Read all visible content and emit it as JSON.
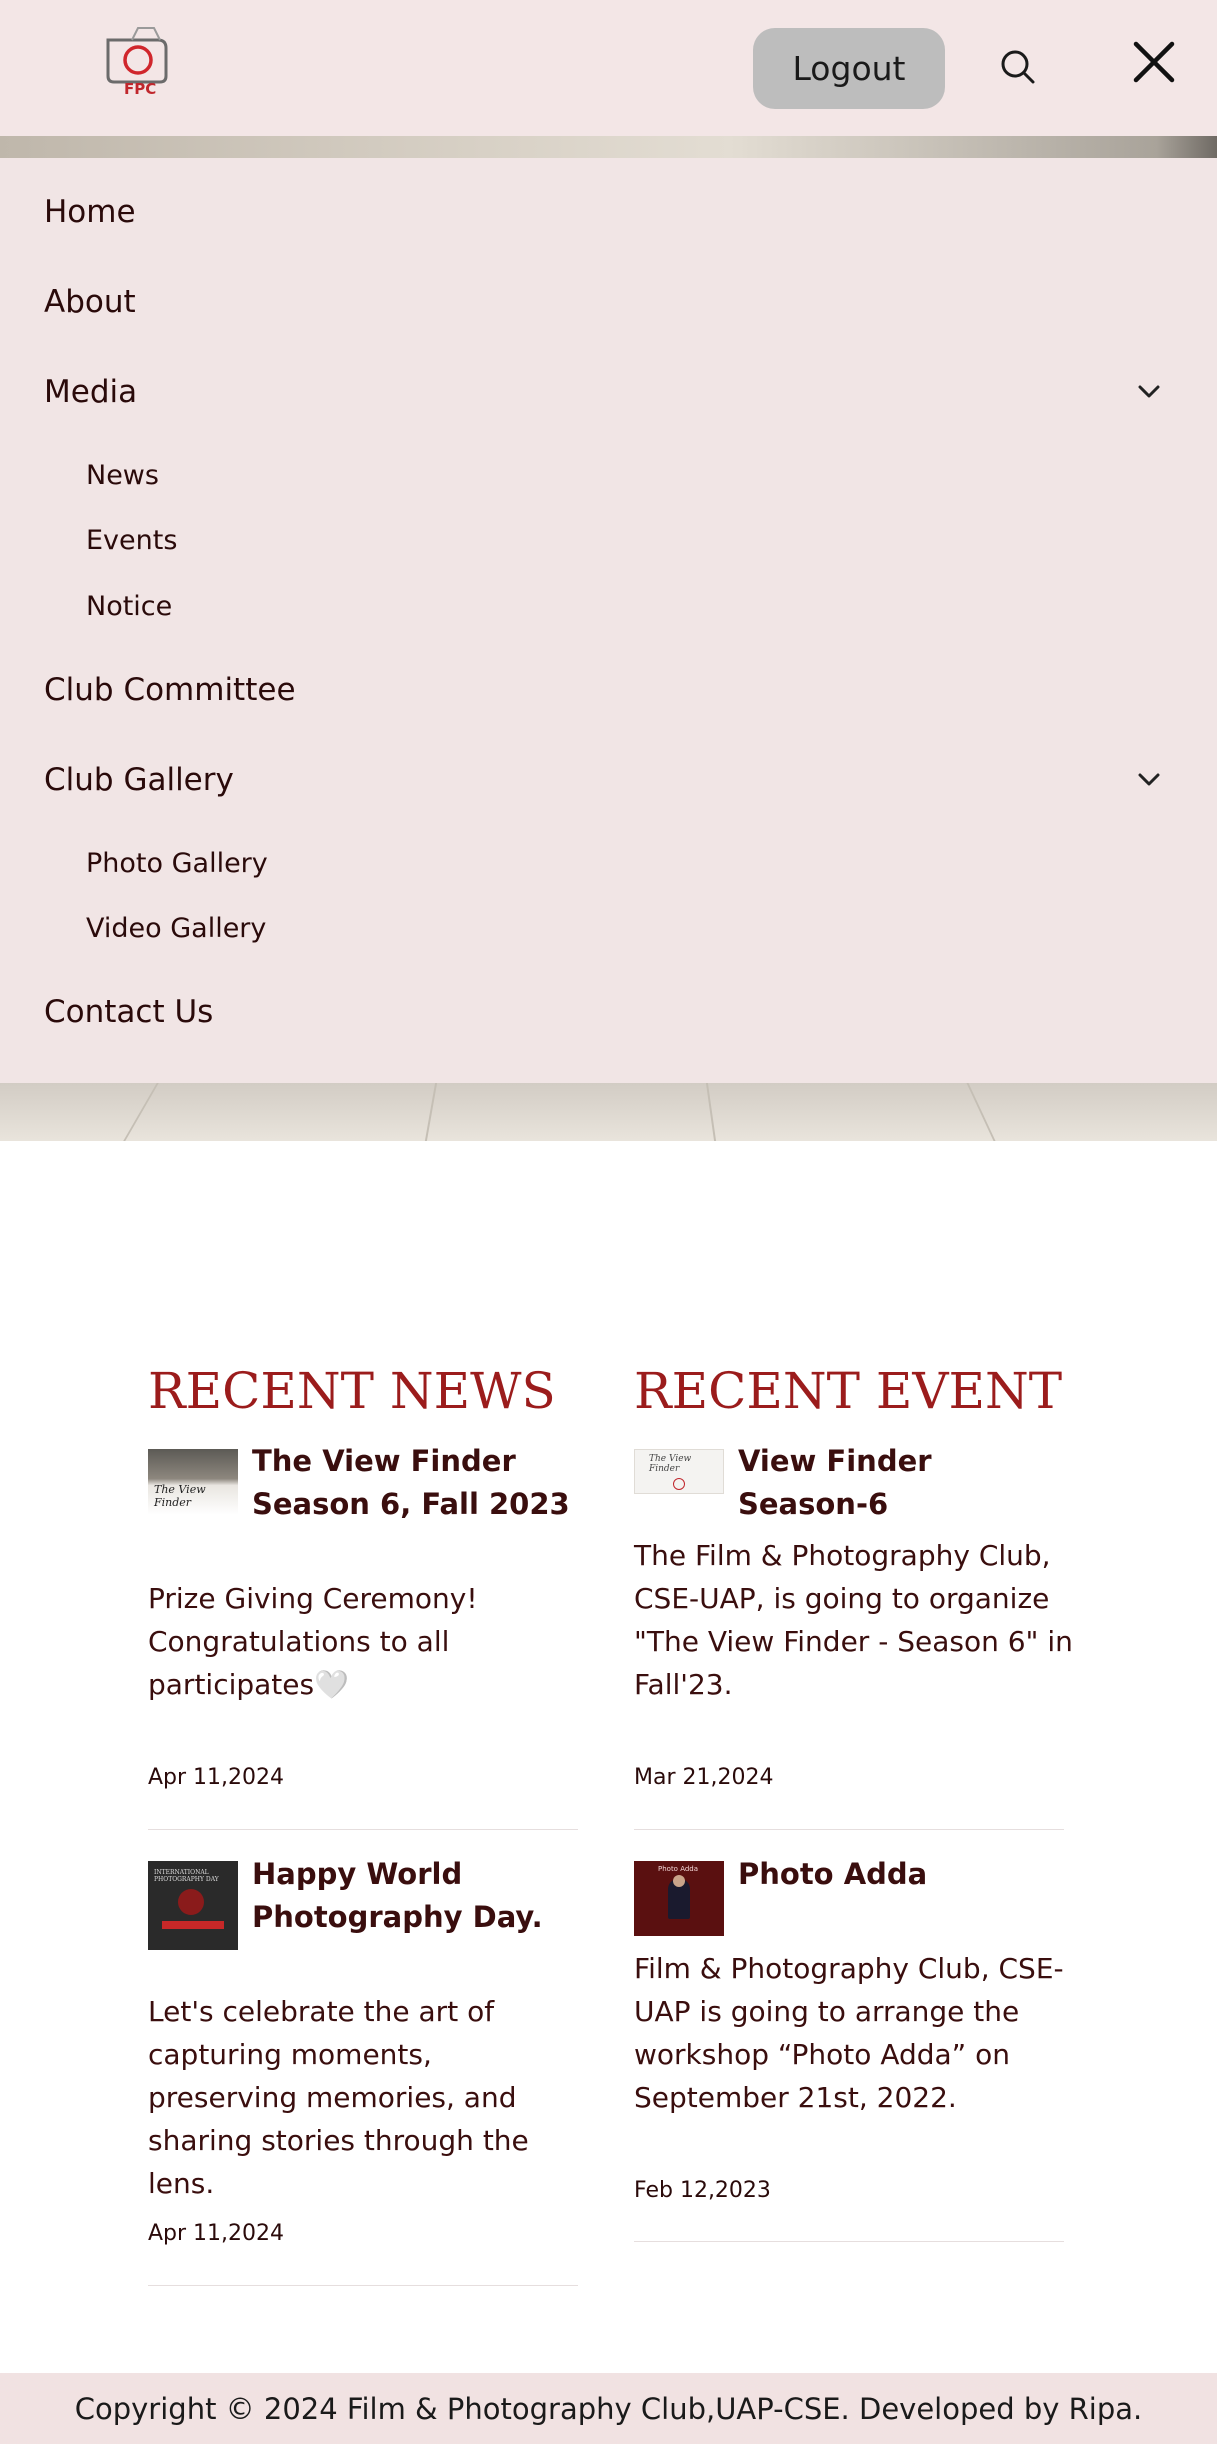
{
  "header": {
    "logo_text": "FPC",
    "logout_label": "Logout"
  },
  "menu": {
    "home": "Home",
    "about": "About",
    "media": "Media",
    "media_sub": [
      "News",
      "Events",
      "Notice"
    ],
    "committee": "Club Committee",
    "gallery": "Club Gallery",
    "gallery_sub": [
      "Photo Gallery",
      "Video Gallery"
    ],
    "contact": "Contact Us"
  },
  "news": {
    "title": "RECENT NEWS",
    "items": [
      {
        "title": "The View Finder Season 6, Fall 2023",
        "text": "Prize Giving Ceremony! Congratulations to all participates🤍",
        "date": "Apr 11,2024",
        "thumb_text": "The View Finder"
      },
      {
        "title": "Happy World Photography Day.",
        "text": "Let's celebrate the art of capturing moments, preserving memories, and sharing stories through the lens.",
        "date": "Apr 11,2024",
        "thumb_text": "INTERNATIONAL PHOTOGRAPHY DAY"
      }
    ]
  },
  "events": {
    "title": "RECENT EVENT",
    "items": [
      {
        "title": "View Finder Season-6",
        "text": "The Film & Photography Club, CSE-UAP, is going to organize \"The View Finder - Season 6\" in Fall'23.",
        "date": "Mar 21,2024",
        "thumb_text": "The View Finder"
      },
      {
        "title": "Photo Adda",
        "text": "Film & Photography Club, CSE-UAP is going to arrange the workshop “Photo Adda” on September 21st, 2022.",
        "date": "Feb 12,2023",
        "thumb_text": "Photo Adda"
      }
    ]
  },
  "footer": {
    "copyright": "Copyright © 2024 Film & Photography Club,UAP-CSE. Developed by Ripa."
  },
  "colors": {
    "accent": "#9b1c1c",
    "header_bg": "#f3e6e6",
    "logout_bg": "#bdbdbd",
    "footer_bg": "#f1e2e2"
  },
  "icons": [
    "camera-logo-icon",
    "search-icon",
    "close-icon",
    "chevron-down-icon"
  ]
}
